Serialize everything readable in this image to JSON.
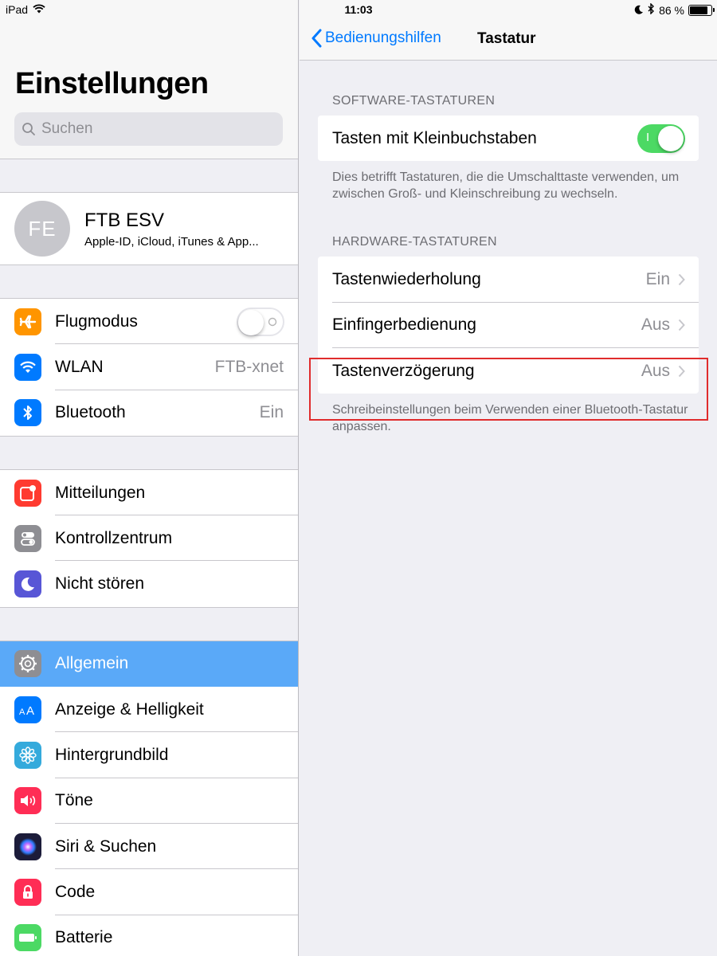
{
  "status_bar": {
    "device": "iPad",
    "time": "11:03",
    "battery_percent": "86 %",
    "battery_level": 0.86
  },
  "master": {
    "title": "Einstellungen",
    "search_placeholder": "Suchen",
    "profile": {
      "initials": "FE",
      "name": "FTB ESV",
      "subtitle": "Apple-ID, iCloud, iTunes & App..."
    },
    "group1": [
      {
        "label": "Flugmodus",
        "icon": "airplane-icon",
        "color": "#ff9500",
        "toggle": false
      },
      {
        "label": "WLAN",
        "icon": "wifi-icon",
        "color": "#007aff",
        "value": "FTB-xnet"
      },
      {
        "label": "Bluetooth",
        "icon": "bluetooth-icon",
        "color": "#007aff",
        "value": "Ein"
      }
    ],
    "group2": [
      {
        "label": "Mitteilungen",
        "icon": "notifications-icon",
        "color": "#ff3b30"
      },
      {
        "label": "Kontrollzentrum",
        "icon": "control-center-icon",
        "color": "#8e8e93"
      },
      {
        "label": "Nicht stören",
        "icon": "moon-icon",
        "color": "#5856d6"
      }
    ],
    "group3": [
      {
        "label": "Allgemein",
        "icon": "gear-icon",
        "color": "#8e8e93",
        "selected": true
      },
      {
        "label": "Anzeige & Helligkeit",
        "icon": "text-size-icon",
        "color": "#007aff"
      },
      {
        "label": "Hintergrundbild",
        "icon": "flower-icon",
        "color": "#34aadc"
      },
      {
        "label": "Töne",
        "icon": "speaker-icon",
        "color": "#ff2d55"
      },
      {
        "label": "Siri & Suchen",
        "icon": "siri-icon",
        "color": "#1c1c3a"
      },
      {
        "label": "Code",
        "icon": "lock-icon",
        "color": "#ff2d55"
      },
      {
        "label": "Batterie",
        "icon": "battery-icon",
        "color": "#4cd964"
      }
    ]
  },
  "detail": {
    "back_label": "Bedienungshilfen",
    "title": "Tastatur",
    "software_header": "SOFTWARE-TASTATUREN",
    "lowercase_label": "Tasten mit Kleinbuchstaben",
    "lowercase_on": true,
    "toggle_on_mark": "I",
    "software_footer": "Dies betrifft Tastaturen, die die Umschalttaste verwenden, um zwischen Groß- und Kleinschreibung zu wechseln.",
    "hardware_header": "HARDWARE-TASTATUREN",
    "hardware_rows": [
      {
        "label": "Tastenwiederholung",
        "value": "Ein"
      },
      {
        "label": "Einfingerbedienung",
        "value": "Aus"
      },
      {
        "label": "Tastenverzögerung",
        "value": "Aus"
      }
    ],
    "hardware_footer": "Schreibeinstellungen beim Verwenden einer Bluetooth-Tastatur anpassen."
  }
}
